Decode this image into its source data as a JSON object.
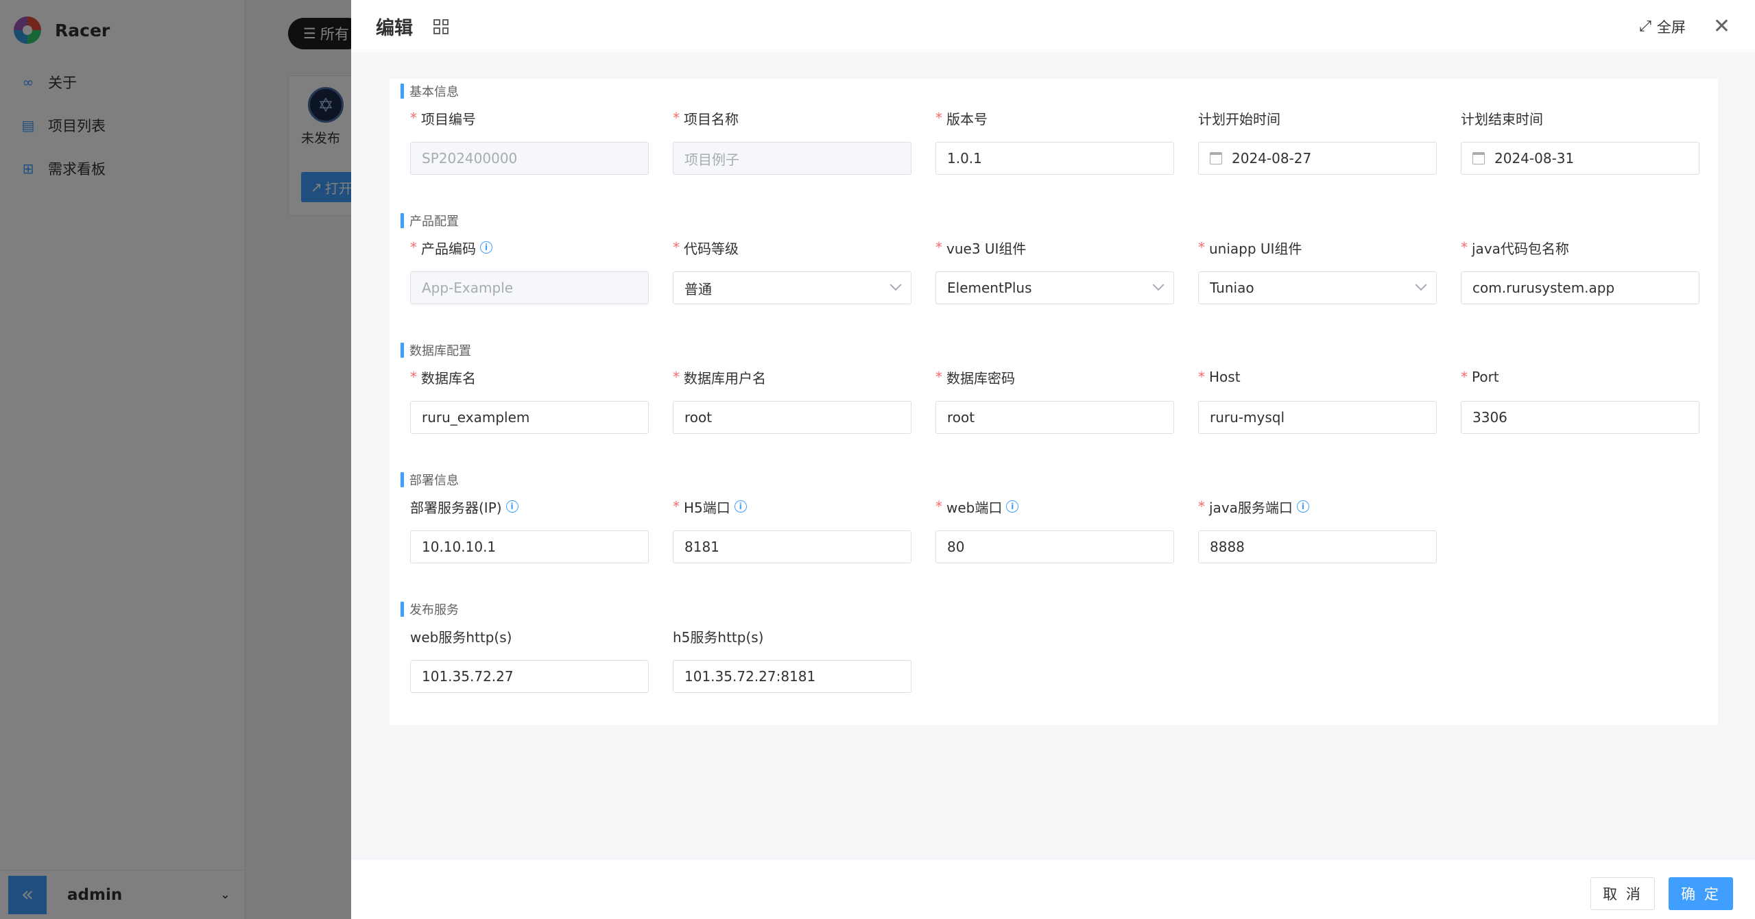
{
  "app": {
    "brand_name": "Racer"
  },
  "sidebar": {
    "items": [
      {
        "label": "关于",
        "icon": "link-icon"
      },
      {
        "label": "项目列表",
        "icon": "document-icon"
      },
      {
        "label": "需求看板",
        "icon": "board-icon"
      }
    ],
    "collapse_glyph": "«",
    "user": "admin"
  },
  "background": {
    "filter_label": "所有",
    "project_status": "未发布",
    "open_label": "打开"
  },
  "drawer": {
    "title": "编辑",
    "fullscreen_label": "全屏",
    "sections": {
      "basic": "基本信息",
      "product": "产品配置",
      "database": "数据库配置",
      "deploy": "部署信息",
      "publish": "发布服务"
    },
    "fields": {
      "project_code": {
        "label": "项目编号",
        "value": "SP202400000"
      },
      "project_name": {
        "label": "项目名称",
        "value": "项目例子"
      },
      "version": {
        "label": "版本号",
        "value": "1.0.1"
      },
      "plan_start": {
        "label": "计划开始时间",
        "value": "2024-08-27"
      },
      "plan_end": {
        "label": "计划结束时间",
        "value": "2024-08-31"
      },
      "product_code": {
        "label": "产品编码",
        "value": "App-Example"
      },
      "code_level": {
        "label": "代码等级",
        "value": "普通"
      },
      "vue3_ui": {
        "label": "vue3 UI组件",
        "value": "ElementPlus"
      },
      "uniapp_ui": {
        "label": "uniapp UI组件",
        "value": "Tuniao"
      },
      "java_package": {
        "label": "java代码包名称",
        "value": "com.rurusystem.app"
      },
      "db_name": {
        "label": "数据库名",
        "value": "ruru_examplem"
      },
      "db_user": {
        "label": "数据库用户名",
        "value": "root"
      },
      "db_password": {
        "label": "数据库密码",
        "value": "root"
      },
      "db_host": {
        "label": "Host",
        "value": "ruru-mysql"
      },
      "db_port": {
        "label": "Port",
        "value": "3306"
      },
      "deploy_server": {
        "label": "部署服务器(IP)",
        "value": "10.10.10.1"
      },
      "h5_port": {
        "label": "H5端口",
        "value": "8181"
      },
      "web_port": {
        "label": "web端口",
        "value": "80"
      },
      "java_port": {
        "label": "java服务端口",
        "value": "8888"
      },
      "web_http": {
        "label": "web服务http(s)",
        "value": "101.35.72.27"
      },
      "h5_http": {
        "label": "h5服务http(s)",
        "value": "101.35.72.27:8181"
      }
    },
    "footer": {
      "cancel_label": "取 消",
      "confirm_label": "确 定"
    }
  },
  "colors": {
    "primary": "#409eff",
    "required": "#f56c6c",
    "overlay": "rgba(0,0,0,0.5)"
  }
}
